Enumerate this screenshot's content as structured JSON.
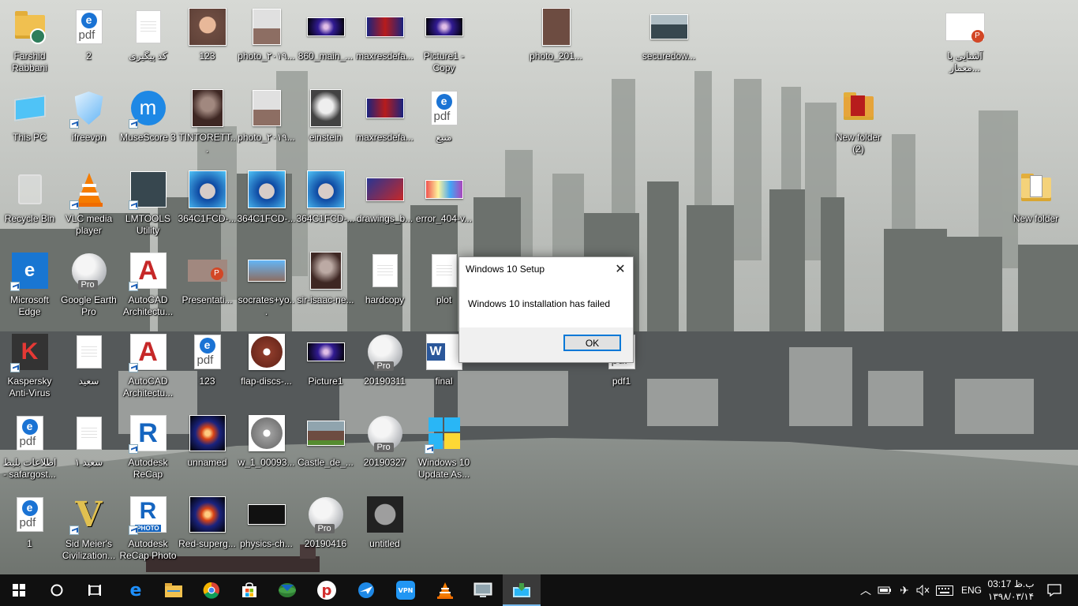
{
  "desktop": {
    "icons": [
      {
        "label": "Farshid Rabbani",
        "kind": "folder-user"
      },
      {
        "label": "2",
        "kind": "pdf"
      },
      {
        "label": "کد پیگیری",
        "kind": "doc"
      },
      {
        "label": "123",
        "kind": "photo-face"
      },
      {
        "label": "photo_۲۰۱۹...",
        "kind": "photo-room"
      },
      {
        "label": "860_main_...",
        "kind": "photo-space"
      },
      {
        "label": "maxresdefa...",
        "kind": "photo-dark"
      },
      {
        "label": "Picture1 - Copy",
        "kind": "photo-space"
      },
      {
        "label": "photo_201...",
        "kind": "photo-brown"
      },
      {
        "label": "securedow...",
        "kind": "photo-group"
      },
      {
        "label": "آشنایی با معمار...",
        "kind": "ppt"
      },
      {
        "label": "This PC",
        "kind": "pc"
      },
      {
        "label": "ifreevpn",
        "kind": "shield"
      },
      {
        "label": "MuseScore 3",
        "kind": "musescore"
      },
      {
        "label": "TINTORETT...",
        "kind": "photo-painting"
      },
      {
        "label": "photo_۲۰۱۹...",
        "kind": "photo-room"
      },
      {
        "label": "einstein",
        "kind": "photo-gray"
      },
      {
        "label": "maxresdefa...",
        "kind": "photo-dark"
      },
      {
        "label": "منبع",
        "kind": "pdf"
      },
      {
        "label": "New folder (2)",
        "kind": "folder-red"
      },
      {
        "label": "Recycle Bin",
        "kind": "recycle"
      },
      {
        "label": "VLC media player",
        "kind": "vlc"
      },
      {
        "label": "LMTOOLS Utility",
        "kind": "lmtools"
      },
      {
        "label": "364C1FCD-...",
        "kind": "photo-face2"
      },
      {
        "label": "364C1FCD-...",
        "kind": "photo-face2"
      },
      {
        "label": "364C1FCD-...",
        "kind": "photo-face2"
      },
      {
        "label": "drawings_b...",
        "kind": "photo-red"
      },
      {
        "label": "error_404-v...",
        "kind": "photo-colorful"
      },
      {
        "label": "New folder",
        "kind": "folder-white"
      },
      {
        "label": "Microsoft Edge",
        "kind": "edge"
      },
      {
        "label": "Google Earth Pro",
        "kind": "earth"
      },
      {
        "label": "AutoCAD Architectu...",
        "kind": "autocad"
      },
      {
        "label": "Presentati...",
        "kind": "ppt-photo"
      },
      {
        "label": "socrates+yo...",
        "kind": "photo-blue"
      },
      {
        "label": "sir-isaac-ne...",
        "kind": "photo-newton"
      },
      {
        "label": "hardcopy",
        "kind": "doc"
      },
      {
        "label": "plot",
        "kind": "doc"
      },
      {
        "label": "Kaspersky Anti-Virus",
        "kind": "kaspersky"
      },
      {
        "label": "سعید",
        "kind": "doc"
      },
      {
        "label": "AutoCAD Architectu...",
        "kind": "autocad"
      },
      {
        "label": "123",
        "kind": "pdf"
      },
      {
        "label": "flap-discs-...",
        "kind": "photo-disc"
      },
      {
        "label": "Picture1",
        "kind": "photo-space"
      },
      {
        "label": "20190311",
        "kind": "earth"
      },
      {
        "label": "final",
        "kind": "word"
      },
      {
        "label": "pdf1",
        "kind": "pdf"
      },
      {
        "label": "اطلاعات بلیط - safargost...",
        "kind": "pdf"
      },
      {
        "label": "سعید ۱",
        "kind": "doc"
      },
      {
        "label": "Autodesk ReCap",
        "kind": "recap"
      },
      {
        "label": "unnamed",
        "kind": "photo-nebula"
      },
      {
        "label": "w_1_00093...",
        "kind": "photo-disc2"
      },
      {
        "label": "Castle_de_...",
        "kind": "photo-castle"
      },
      {
        "label": "20190327",
        "kind": "earth"
      },
      {
        "label": "Windows 10 Update As...",
        "kind": "win10"
      },
      {
        "label": "1",
        "kind": "pdf"
      },
      {
        "label": "Sid Meier's Civilization...",
        "kind": "civ"
      },
      {
        "label": "Autodesk ReCap Photo",
        "kind": "recap-photo"
      },
      {
        "label": "Red-superg...",
        "kind": "photo-nebula"
      },
      {
        "label": "physics-ch...",
        "kind": "photo-stars"
      },
      {
        "label": "20190416",
        "kind": "earth"
      },
      {
        "label": "untitled",
        "kind": "hdr"
      }
    ]
  },
  "dialog": {
    "title": "Windows 10 Setup",
    "message": "Windows 10 installation has failed",
    "ok_label": "OK",
    "close_glyph": "✕"
  },
  "taskbar": {
    "apps": [
      {
        "name": "start",
        "glyph": "⊞"
      },
      {
        "name": "search",
        "glyph": "○"
      },
      {
        "name": "task-view",
        "glyph": "▭"
      },
      {
        "name": "edge",
        "glyph": "e"
      },
      {
        "name": "file-explorer",
        "glyph": "▬"
      },
      {
        "name": "chrome",
        "glyph": "◉"
      },
      {
        "name": "store",
        "glyph": "▦"
      },
      {
        "name": "internet-download-manager",
        "glyph": "◐"
      },
      {
        "name": "psiphon",
        "glyph": "p"
      },
      {
        "name": "vpn-client",
        "glyph": "✈"
      },
      {
        "name": "vpn",
        "glyph": "◆"
      },
      {
        "name": "vlc",
        "glyph": "▲"
      },
      {
        "name": "remote-desktop",
        "glyph": "▣"
      },
      {
        "name": "windows-setup",
        "glyph": "▤"
      }
    ],
    "tray": {
      "language": "ENG",
      "time": "03:17 ب.ظ",
      "date": "۱۳۹۸/۰۳/۱۴"
    }
  }
}
